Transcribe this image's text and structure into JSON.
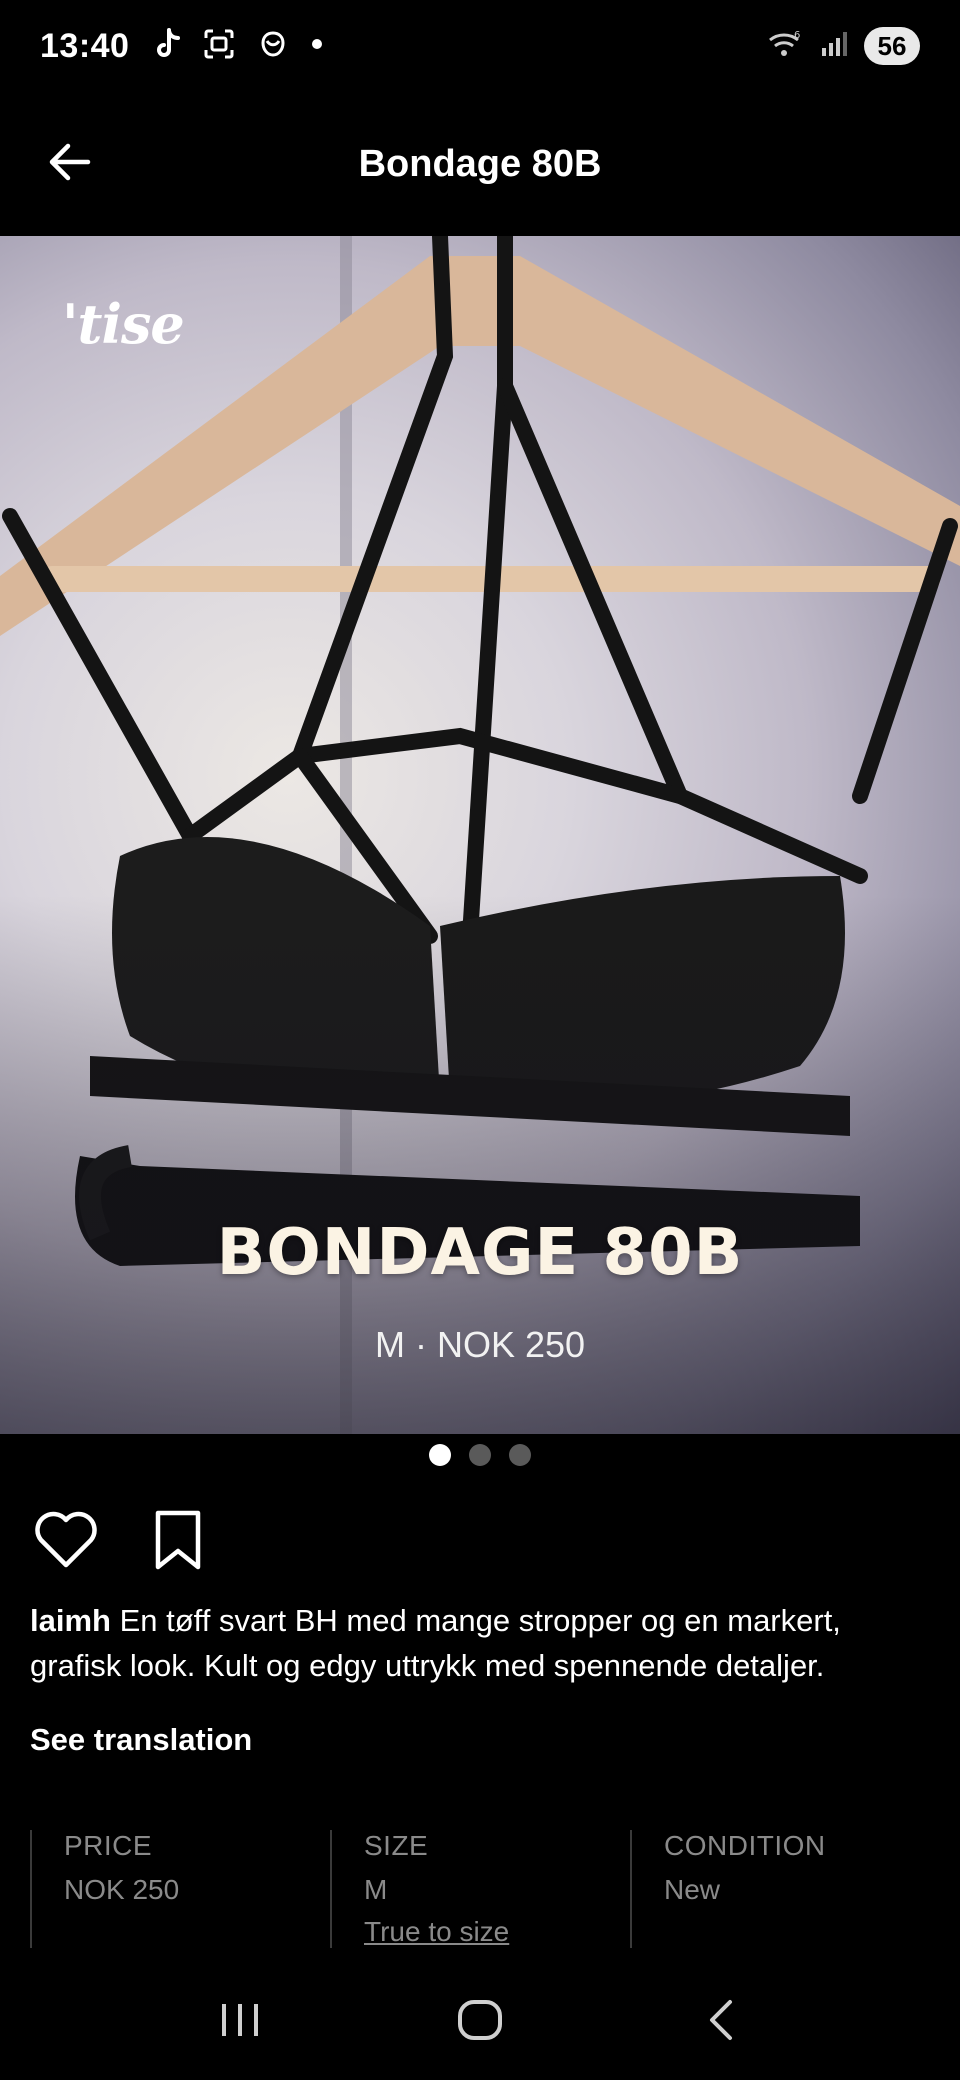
{
  "status_bar": {
    "time": "13:40",
    "left_icons": [
      "tiktok-icon",
      "screenshot-icon",
      "app-icon",
      "dot-icon"
    ],
    "right_icons": [
      "wifi-icon",
      "signal-icon"
    ],
    "battery": "56"
  },
  "header": {
    "back_icon": "arrow-left-icon",
    "title": "Bondage 80B"
  },
  "hero": {
    "brand": "'tise",
    "title": "BONDAGE 80B",
    "subtitle": "M · NOK 250"
  },
  "carousel": {
    "count": 3,
    "active_index": 0
  },
  "actions": {
    "like_icon": "heart-icon",
    "save_icon": "bookmark-icon"
  },
  "description": {
    "username": "laimh",
    "text": " En tøff svart BH med mange stropper og en markert, grafisk look. Kult og edgy uttrykk med spennende detaljer."
  },
  "see_translation": "See translation",
  "details": [
    {
      "label": "PRICE",
      "value": "NOK 250"
    },
    {
      "label": "SIZE",
      "value": "M",
      "link": "True to size"
    },
    {
      "label": "CONDITION",
      "value": "New"
    }
  ],
  "nav_bar": {
    "icons": [
      "recent-apps-icon",
      "home-icon",
      "back-icon"
    ]
  },
  "colors": {
    "background": "#000000",
    "text": "#ffffff",
    "muted": "#8a8a8a",
    "hero_title": "#fbf3e4"
  }
}
